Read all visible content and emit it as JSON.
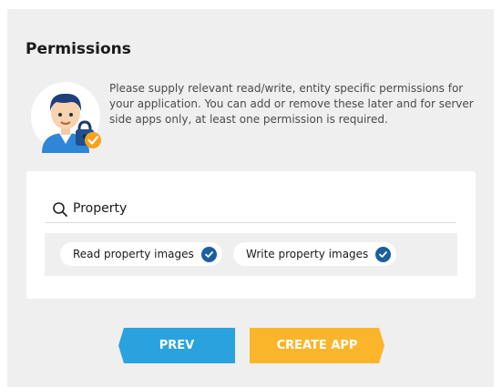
{
  "permissions": {
    "title": "Permissions",
    "description": "Please supply relevant read/write, entity specific permissions for your application. You can add or remove these later and for server side apps only, at least one permission is required."
  },
  "search": {
    "value": "Property",
    "placeholder": ""
  },
  "selected_permissions": [
    {
      "label": "Read property images",
      "checked": true
    },
    {
      "label": "Write property images",
      "checked": true
    }
  ],
  "buttons": {
    "prev_label": "PREV",
    "create_label": "CREATE APP"
  },
  "colors": {
    "prev_button": "#29a2de",
    "create_button": "#fbb52a",
    "check_badge": "#1b5fa0",
    "panel_background": "#efefef"
  },
  "icons": {
    "avatar": "user-with-padlock-illustration",
    "search": "search-icon",
    "check": "check-icon"
  }
}
